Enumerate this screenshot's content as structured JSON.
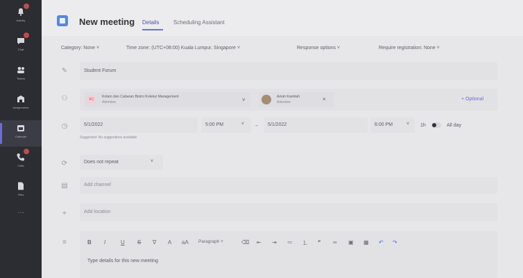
{
  "rail": {
    "items": [
      {
        "label": "Activity",
        "icon": "bell-icon",
        "badge": true
      },
      {
        "label": "Chat",
        "icon": "chat-icon",
        "badge": true
      },
      {
        "label": "Teams",
        "icon": "teams-icon",
        "badge": false
      },
      {
        "label": "Assignments",
        "icon": "assignments-icon",
        "badge": false
      },
      {
        "label": "Calendar",
        "icon": "calendar-icon",
        "badge": false,
        "active": true
      },
      {
        "label": "Calls",
        "icon": "phone-icon",
        "badge": true
      },
      {
        "label": "Files",
        "icon": "file-icon",
        "badge": false
      }
    ],
    "more": "···"
  },
  "header": {
    "title": "New meeting",
    "tabs": [
      {
        "label": "Details",
        "active": true
      },
      {
        "label": "Scheduling Assistant",
        "active": false
      }
    ]
  },
  "toolbar": {
    "category": "Category: None",
    "timezone": "Time zone: (UTC+08:00) Kuala Lumpur, Singapore",
    "response": "Response options",
    "registration": "Require registration: None"
  },
  "form": {
    "title": "Student Forum",
    "attendees": [
      {
        "name": "Kolam dan Cabaran Bistro Koleksi Management",
        "sub": "Attendee",
        "initials": "KC"
      },
      {
        "name": "Aziah Kamilah",
        "sub": "Attendee"
      }
    ],
    "optional": "+ Optional",
    "start_date": "5/1/2022",
    "start_time": "5:00 PM",
    "end_date": "5/1/2022",
    "end_time": "6:00 PM",
    "duration": "1h",
    "allday": "All day",
    "suggestion": "Suggested: No suggestions available",
    "repeat": "Does not repeat",
    "channel_placeholder": "Add channel",
    "location_placeholder": "Add location",
    "details_placeholder": "Type details for this new meeting",
    "format_paragraph": "Paragraph"
  },
  "colors": {
    "rail": "#2c2c33",
    "accent": "#6b6fd1",
    "badge": "#c44a4a",
    "app_icon": "#5b86d6"
  }
}
